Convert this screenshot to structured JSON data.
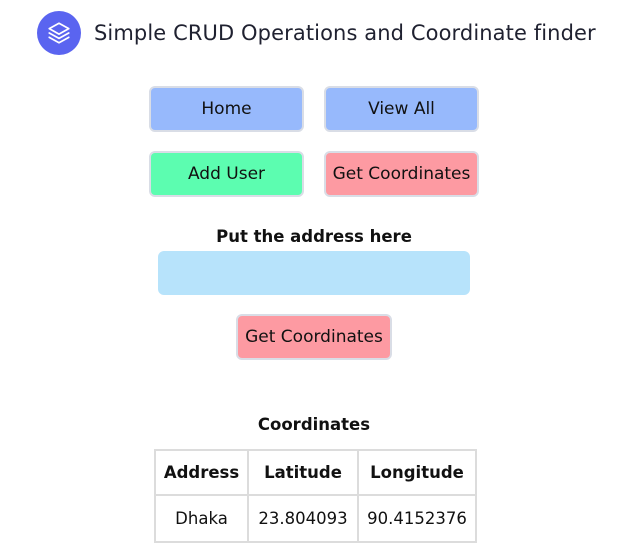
{
  "header": {
    "logo_icon": "layers-stack-icon",
    "title": "Simple CRUD Operations and Coordinate finder"
  },
  "nav": {
    "home": "Home",
    "view_all": "View All",
    "add_user": "Add User",
    "get_coordinates": "Get Coordinates"
  },
  "form": {
    "address_label": "Put the address here",
    "address_value": "",
    "submit_label": "Get Coordinates"
  },
  "results": {
    "title": "Coordinates",
    "columns": [
      "Address",
      "Latitude",
      "Longitude"
    ],
    "rows": [
      [
        "Dhaka",
        "23.804093",
        "90.4152376"
      ]
    ]
  },
  "colors": {
    "logo": "#5a64f0",
    "blue_button": "#97b9fc",
    "green_button": "#5cfdb0",
    "pink_button": "#fd9aa2",
    "input_bg": "#b7e3fb"
  }
}
